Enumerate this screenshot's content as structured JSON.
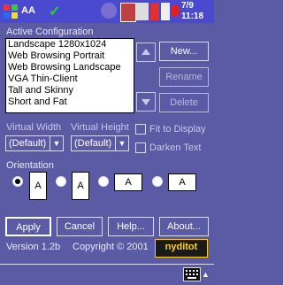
{
  "taskbar": {
    "aa_label": "AA",
    "time_line1": "7/9",
    "time_line2": "11:18",
    "icons": [
      "start-icon",
      "font-size-icon",
      "ok-check-icon",
      "moon-icon",
      "app-icon",
      "disk-icon",
      "battery-icon",
      "signal-icon",
      "record-icon"
    ]
  },
  "config": {
    "title": "Active Configuration",
    "items": [
      "Landscape 1280x1024",
      "Web Browsing Portrait",
      "Web Browsing Landscape",
      "VGA Thin-Client",
      "Tall and Skinny",
      "Short and Fat"
    ],
    "new_label": "New...",
    "rename_label": "Rename",
    "delete_label": "Delete"
  },
  "virtual": {
    "width_label": "Virtual Width",
    "height_label": "Virtual Height",
    "width_value": "(Default)",
    "height_value": "(Default)",
    "fit_label": "Fit to Display",
    "darken_label": "Darken Text"
  },
  "orientation": {
    "title": "Orientation",
    "options": [
      "A",
      "A",
      "A",
      "A"
    ],
    "selected_index": 0
  },
  "actions": {
    "apply": "Apply",
    "cancel": "Cancel",
    "help": "Help...",
    "about": "About..."
  },
  "footer": {
    "version": "Version 1.2b",
    "copyright": "Copyright © 2001",
    "logo": "nyditot"
  },
  "colors": {
    "background": "#5a5aa5",
    "taskbar": "#4a4ad0",
    "logo_bg": "#1a1a1a",
    "logo_fg": "#ffd200"
  }
}
